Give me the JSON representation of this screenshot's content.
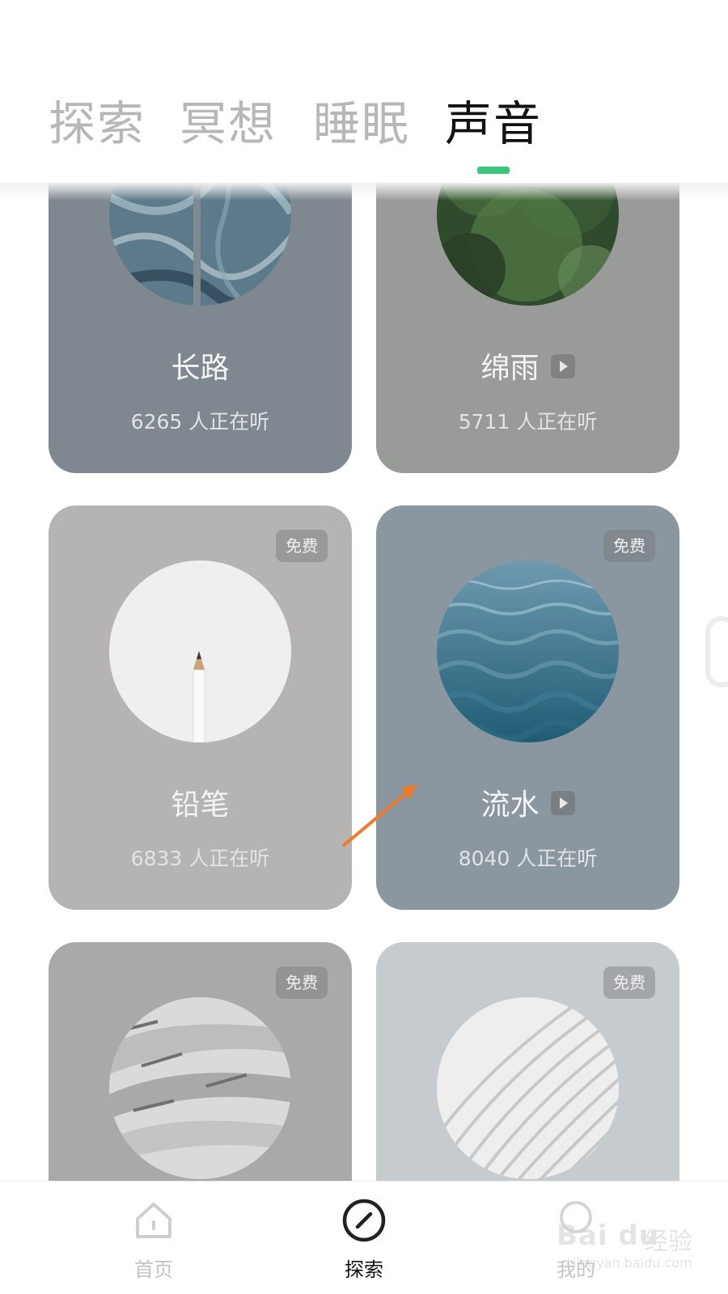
{
  "tabs": [
    {
      "label": "探索",
      "active": false
    },
    {
      "label": "冥想",
      "active": false
    },
    {
      "label": "睡眠",
      "active": false
    },
    {
      "label": "声音",
      "active": true
    }
  ],
  "accent_color": "#3cc47c",
  "cards": [
    {
      "title": "长路",
      "listeners": "6265 人正在听",
      "free_badge": "",
      "has_play": false,
      "cover": "mountain-stream-aerial"
    },
    {
      "title": "绵雨",
      "listeners": "5711 人正在听",
      "free_badge": "",
      "has_play": true,
      "cover": "green-foliage-blur"
    },
    {
      "title": "铅笔",
      "listeners": "6833 人正在听",
      "free_badge": "免费",
      "has_play": false,
      "cover": "pencil-on-white"
    },
    {
      "title": "流水",
      "listeners": "8040 人正在听",
      "free_badge": "免费",
      "has_play": true,
      "cover": "ocean-waves"
    },
    {
      "title": "",
      "listeners": "",
      "free_badge": "免费",
      "has_play": false,
      "cover": "sand-dunes-gray"
    },
    {
      "title": "",
      "listeners": "",
      "free_badge": "免费",
      "has_play": false,
      "cover": "white-curved-lines"
    }
  ],
  "bottom_nav": [
    {
      "label": "首页",
      "icon": "home-icon",
      "active": false
    },
    {
      "label": "探索",
      "icon": "compass-icon",
      "active": true
    },
    {
      "label": "我的",
      "icon": "profile-icon",
      "active": false
    }
  ],
  "watermark": {
    "logo": "Bai du",
    "brand": "经验",
    "url": "jingyan.baidu.com"
  },
  "annotation_color": "#f07a2a"
}
